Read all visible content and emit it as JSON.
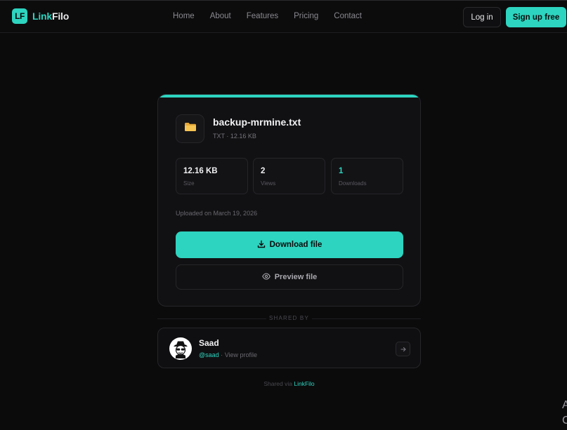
{
  "header": {
    "logo_mark": "LF",
    "brand_part1": "Link",
    "brand_part2": "Filo",
    "nav": [
      "Home",
      "About",
      "Features",
      "Pricing",
      "Contact"
    ],
    "login_label": "Log in",
    "signup_label": "Sign up free"
  },
  "file": {
    "name": "backup-mrmine.txt",
    "meta": "TXT · 12.16 KB",
    "icon": "folder-icon",
    "stats": [
      {
        "value": "12.16 KB",
        "label": "Size"
      },
      {
        "value": "2",
        "label": "Views"
      },
      {
        "value": "1",
        "label": "Downloads"
      }
    ],
    "uploaded": "Uploaded on March 19, 2026",
    "download_label": "Download file",
    "preview_label": "Preview file"
  },
  "shared_by": {
    "heading": "SHARED BY",
    "name": "Saad",
    "handle": "@saad",
    "separator": "·",
    "view_profile": "View profile"
  },
  "footer": {
    "text": "Shared via",
    "brand": "LinkFilo"
  },
  "edge": {
    "line1": "A",
    "line2": "C"
  },
  "colors": {
    "accent": "#2dd4bf",
    "background": "#0b0b0c",
    "card": "#111113"
  }
}
